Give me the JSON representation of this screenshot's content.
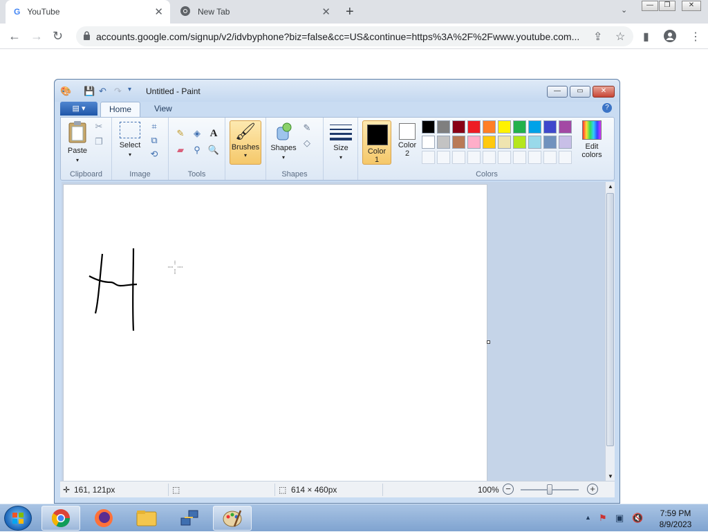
{
  "browser": {
    "tabs": [
      {
        "title": "YouTube",
        "favicon": "G"
      },
      {
        "title": "New Tab",
        "favicon": "chrome-icon"
      }
    ],
    "url": "accounts.google.com/signup/v2/idvbyphone?biz=false&cc=US&continue=https%3A%2F%2Fwww.youtube.com..."
  },
  "paint": {
    "title": "Untitled - Paint",
    "ribbon_tabs": [
      "Home",
      "View"
    ],
    "groups": {
      "clipboard": "Clipboard",
      "image": "Image",
      "tools": "Tools",
      "shapes": "Shapes",
      "colors": "Colors"
    },
    "buttons": {
      "paste": "Paste",
      "select": "Select",
      "brushes": "Brushes",
      "shapes": "Shapes",
      "size": "Size",
      "color1": "Color 1",
      "color2": "Color 2",
      "edit_colors": "Edit colors"
    },
    "palette": [
      "#000000",
      "#7f7f7f",
      "#880015",
      "#ed1c24",
      "#ff7f27",
      "#fff200",
      "#22b14c",
      "#00a2e8",
      "#3f48cc",
      "#a349a4",
      "#ffffff",
      "#c3c3c3",
      "#b97a57",
      "#ffaec9",
      "#ffc90e",
      "#efe4b0",
      "#b5e61d",
      "#99d9ea",
      "#7092be",
      "#c8bfe7"
    ],
    "color1": "#000000",
    "color2": "#ffffff",
    "status": {
      "cursor_pos": "161, 121px",
      "canvas_size": "614 × 460px",
      "zoom": "100%",
      "zoom_level": 1.0
    }
  },
  "taskbar": {
    "time": "7:59 PM",
    "date": "8/9/2023"
  }
}
